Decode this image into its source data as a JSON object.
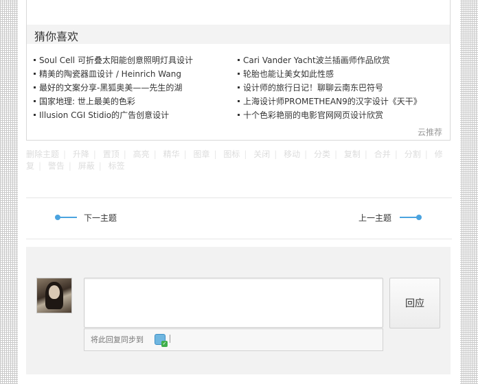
{
  "recommend": {
    "title": "猜你喜欢",
    "left_items": [
      "Soul Cell 可折叠太阳能创意照明灯具设计",
      "精美的陶瓷器皿设计 / Heinrich Wang",
      "最好的文案分享-黑狐奥美——先生的湖",
      "国家地理: 世上最美的色彩",
      "Illusion CGI Stidio的广告创意设计"
    ],
    "right_items": [
      "Cari Vander Yacht波兰插画师作品欣赏",
      "轮胎也能让美女如此性感",
      "设计师的旅行日记！聊聊云南东巴符号",
      "上海设计师PROMETHEAN9的汉字设计《天干》",
      "十个色彩艳丽的电影官网网页设计欣赏"
    ],
    "footer": "云推荐"
  },
  "moderation": {
    "links": [
      "删除主题",
      "升降",
      "置顶",
      "高亮",
      "精华",
      "图章",
      "图标",
      "关闭",
      "移动",
      "分类",
      "复制",
      "合并",
      "分割",
      "修复",
      "警告",
      "屏蔽",
      "标签"
    ]
  },
  "thread_nav": {
    "next_label": "下一主题",
    "prev_label": "上一主题",
    "accent_color": "#4aa3df"
  },
  "reply": {
    "textarea_value": "",
    "sync_label": "将此回复同步到",
    "submit_label": "回应"
  }
}
